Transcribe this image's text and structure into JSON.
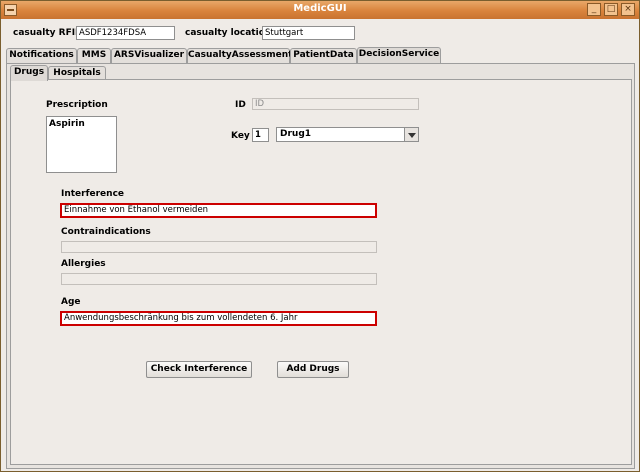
{
  "window": {
    "title": "MedicGUI"
  },
  "header": {
    "rfid_label": "casualty RFID:",
    "rfid_value": "ASDF1234FDSA",
    "location_label": "casualty location:",
    "location_value": "Stuttgart"
  },
  "main_tabs": [
    "Notifications",
    "MMS",
    "ARSVisualizer",
    "CasualtyAssessment",
    "PatientData",
    "DecisionService"
  ],
  "main_tabs_active": "DecisionService",
  "sub_tabs": [
    "Drugs",
    "Hospitals"
  ],
  "sub_tabs_active": "Drugs",
  "drugs": {
    "prescription_label": "Prescription",
    "prescription_items": [
      "Aspirin"
    ],
    "id_label": "ID",
    "id_value": "ID",
    "key_label": "Key",
    "key_value": "1",
    "drug_selected": "Drug1",
    "interference_label": "Interference",
    "interference_value": "Einnahme von Ethanol vermeiden",
    "contraindications_label": "Contraindications",
    "contraindications_value": "",
    "allergies_label": "Allergies",
    "allergies_value": "",
    "age_label": "Age",
    "age_value": "Anwendungsbeschränkung bis zum vollendeten 6. Jahr",
    "check_button": "Check Interference",
    "add_button": "Add Drugs"
  },
  "colors": {
    "titlebar": "#d9833c",
    "error_border": "#cc0000"
  },
  "icons": [
    "window-menu-icon",
    "minimize-icon",
    "maximize-icon",
    "close-icon",
    "dropdown-arrow-icon"
  ]
}
